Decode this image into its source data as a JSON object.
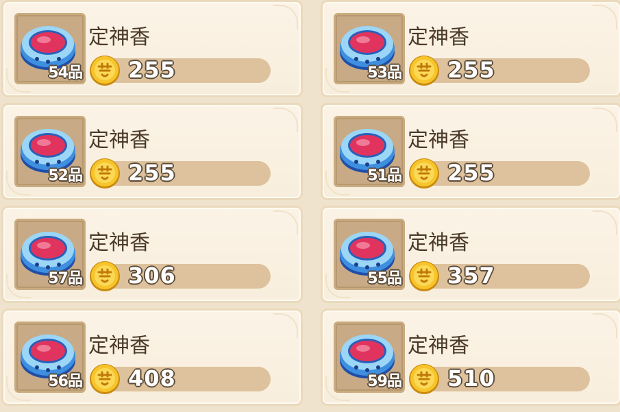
{
  "items": [
    {
      "name": "定神香",
      "grade": "54品",
      "price": "255"
    },
    {
      "name": "定神香",
      "grade": "53品",
      "price": "255"
    },
    {
      "name": "定神香",
      "grade": "52品",
      "price": "255"
    },
    {
      "name": "定神香",
      "grade": "51品",
      "price": "255"
    },
    {
      "name": "定神香",
      "grade": "57品",
      "price": "306"
    },
    {
      "name": "定神香",
      "grade": "55品",
      "price": "357"
    },
    {
      "name": "定神香",
      "grade": "56品",
      "price": "408"
    },
    {
      "name": "定神香",
      "grade": "59品",
      "price": "510"
    }
  ],
  "icons": {
    "item": "incense-bowl-icon",
    "currency": "dream-coin-icon"
  },
  "colors": {
    "card_bg": "#f8eedd",
    "slot_bg": "#c8aa86",
    "price_bar": "#ddc29d",
    "text": "#4b3a2a",
    "coin": "#f2b51c"
  }
}
